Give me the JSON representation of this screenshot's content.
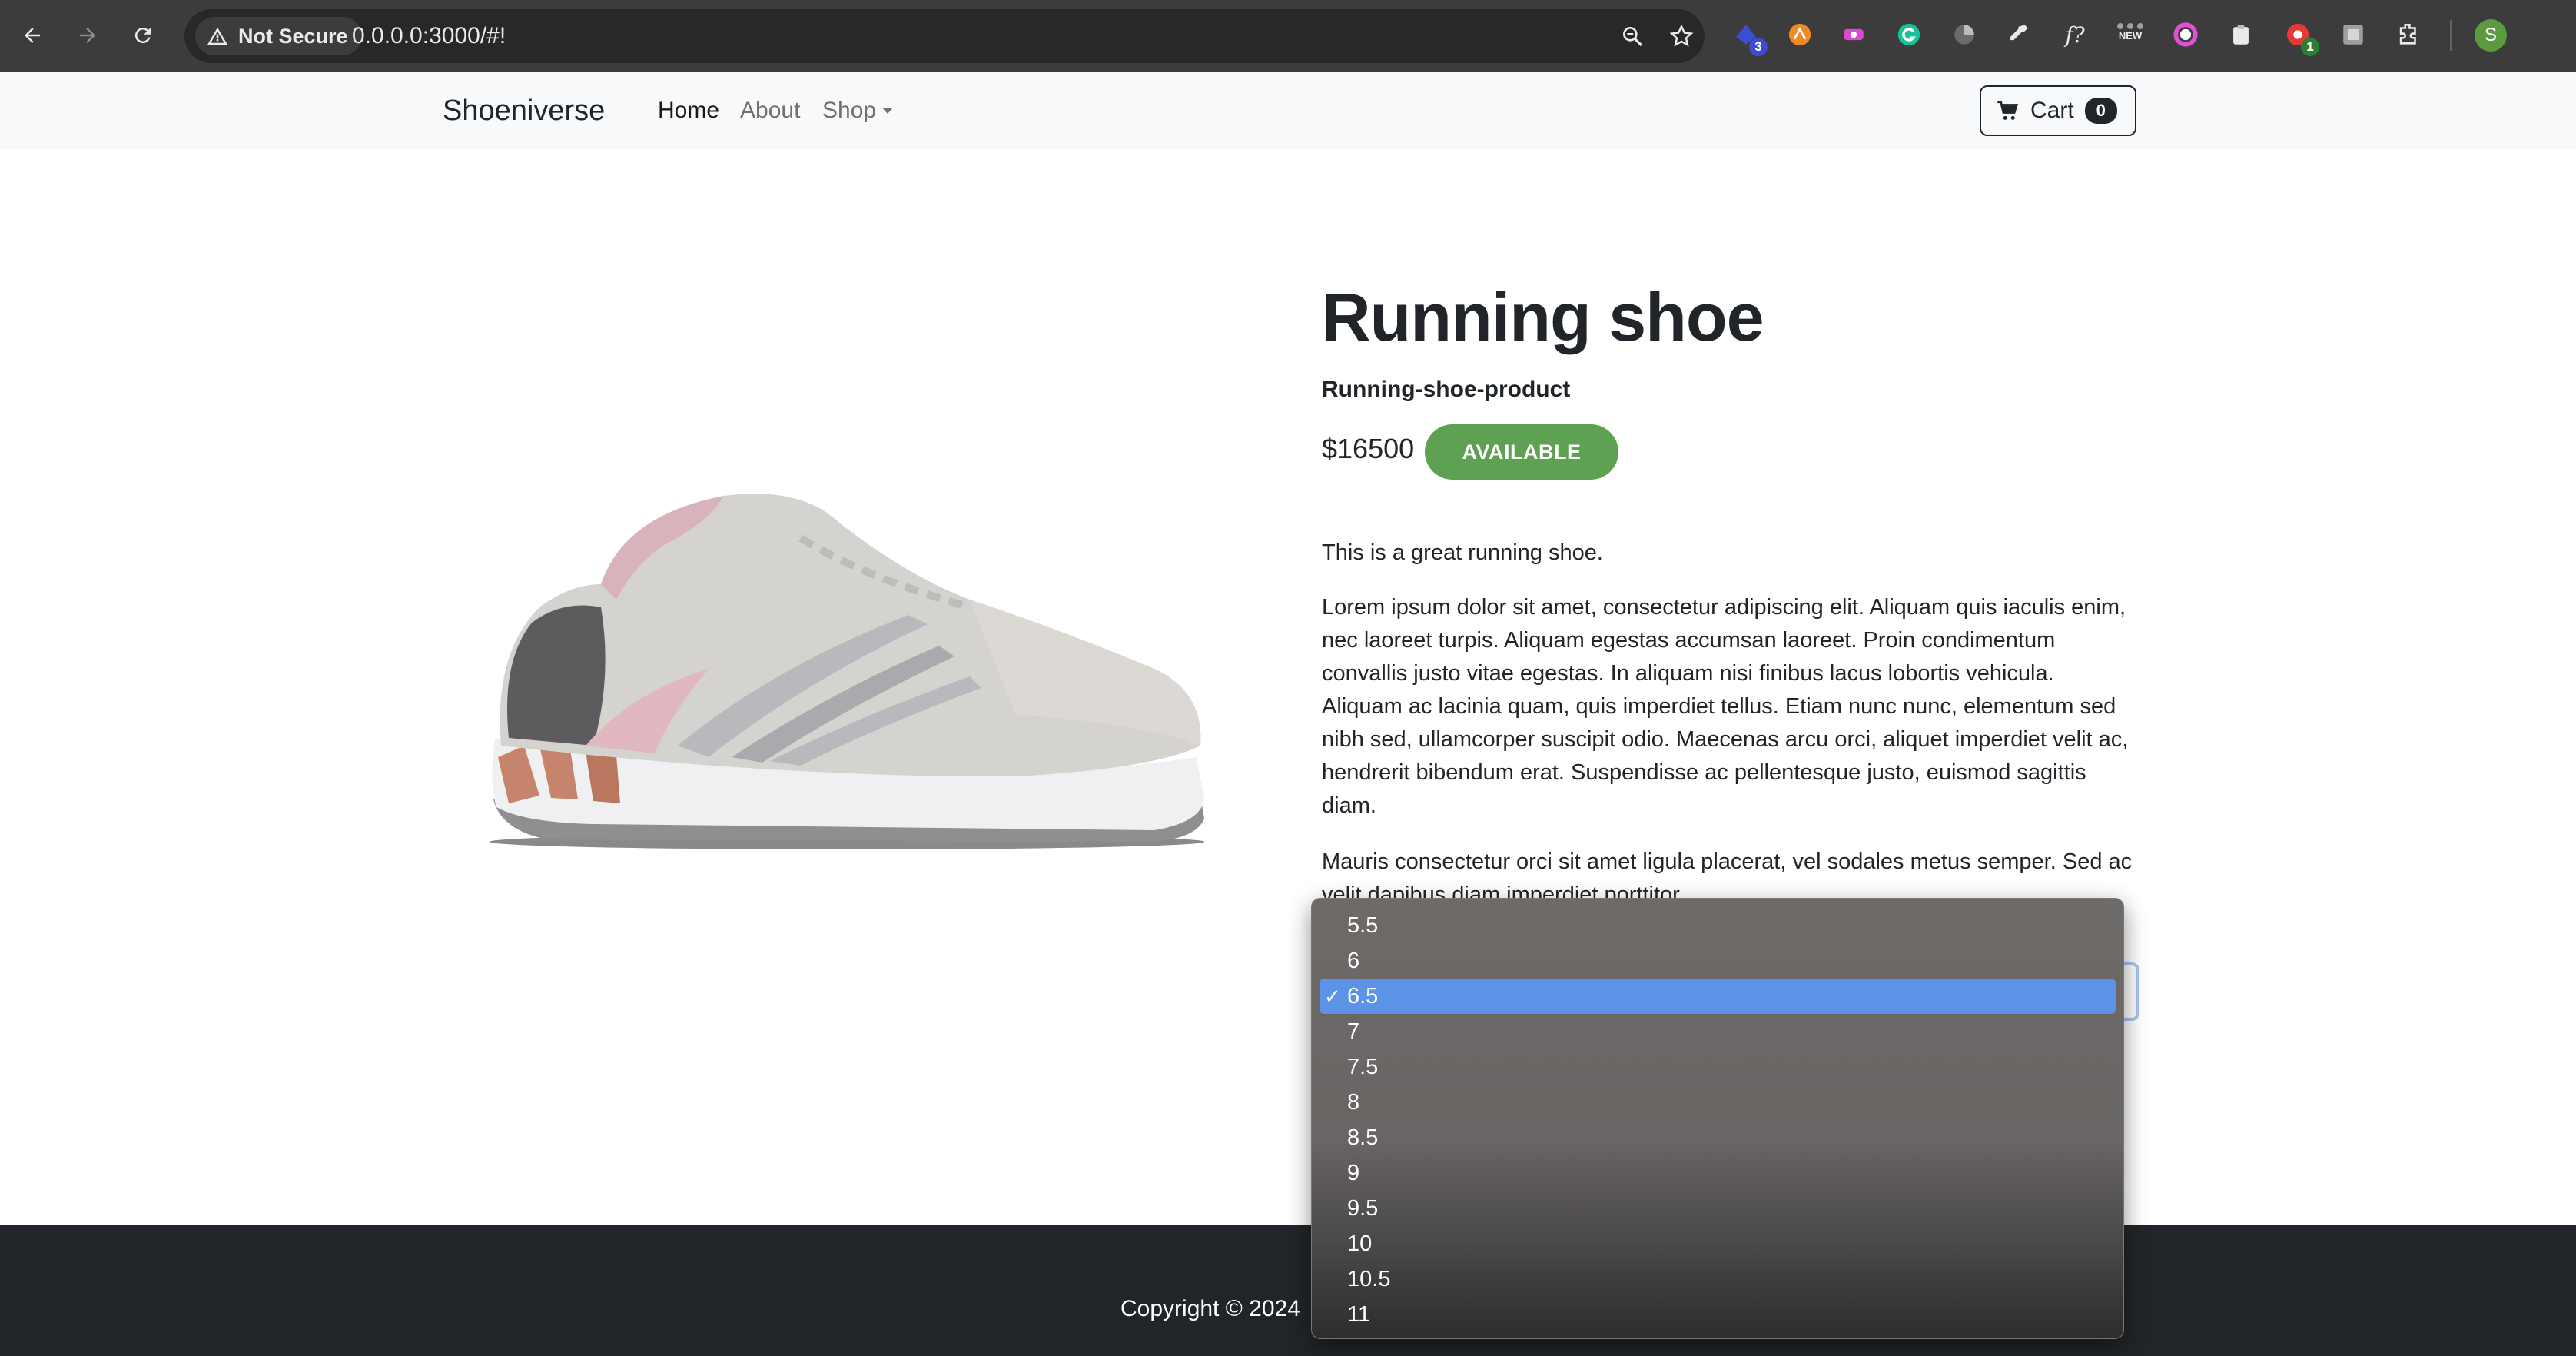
{
  "browser": {
    "security_label": "Not Secure",
    "url": "0.0.0.0:3000/#!",
    "extension_badges": {
      "ext1": "3",
      "ext_red": "1"
    },
    "extension_text": {
      "ext_new": "NEW",
      "ext_fx": "f?"
    },
    "profile_initial": "S"
  },
  "navbar": {
    "brand": "Shoeniverse",
    "links": [
      "Home",
      "About",
      "Shop"
    ],
    "cart_label": "Cart",
    "cart_count": "0"
  },
  "product": {
    "title": "Running shoe",
    "subtitle": "Running-shoe-product",
    "price": "$16500",
    "status": "AVAILABLE",
    "short_description": "This is a great running shoe.",
    "paragraph_1": "Lorem ipsum dolor sit amet, consectetur adipiscing elit. Aliquam quis iaculis enim, nec laoreet turpis. Aliquam egestas accumsan laoreet. Proin condimentum convallis justo vitae egestas. In aliquam nisi finibus lacus lobortis vehicula. Aliquam ac lacinia quam, quis imperdiet tellus. Etiam nunc nunc, elementum sed nibh sed, ullamcorper suscipit odio. Maecenas arcu orci, aliquet imperdiet velit ac, hendrerit bibendum erat. Suspendisse ac pellentesque justo, euismod sagittis diam.",
    "paragraph_2": "Mauris consectetur orci sit amet ligula placerat, vel sodales metus semper. Sed ac velit dapibus diam imperdiet porttitor."
  },
  "size_select": {
    "options": [
      "5.5",
      "6",
      "6.5",
      "7",
      "7.5",
      "8",
      "8.5",
      "9",
      "9.5",
      "10",
      "10.5",
      "11"
    ],
    "selected": "6.5",
    "check_mark": "✓"
  },
  "footer": {
    "copyright": "Copyright © 2024"
  },
  "colors": {
    "available_badge": "#5ea152",
    "selected_option": "#5d93e6",
    "footer_bg": "#212529",
    "navbar_bg": "#f8f9fa"
  }
}
